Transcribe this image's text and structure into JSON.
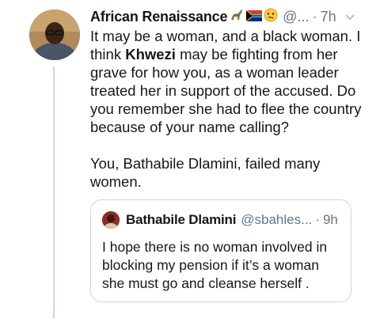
{
  "tweet": {
    "author_name": "African Renaissance",
    "author_emojis": [
      "antelope-emoji",
      "south-africa-flag-emoji",
      "thinking-face-emoji"
    ],
    "handle": "@...",
    "separator": "·",
    "time": "7h",
    "lines": [
      "It may be a woman, and a black woman. I",
      "think",
      "Khwezi",
      "may be fighting from her",
      "grave for how you, as a woman leader",
      "treated her in support of the accused. Do",
      "you remember she had to flee the country",
      "because of your name calling?",
      "You, Bathabile Dlamini, failed many",
      "women."
    ]
  },
  "quoted": {
    "author_name": "Bathabile Dlamini",
    "handle": "@sbahles...",
    "separator": "·",
    "time": "9h",
    "lines": [
      "I hope there is no woman involved in",
      "blocking my pension if it’s a woman",
      "she must go and cleanse herself ."
    ]
  },
  "colors": {
    "text": "#14171a",
    "secondary": "#657786",
    "border": "#ccd6dd"
  }
}
